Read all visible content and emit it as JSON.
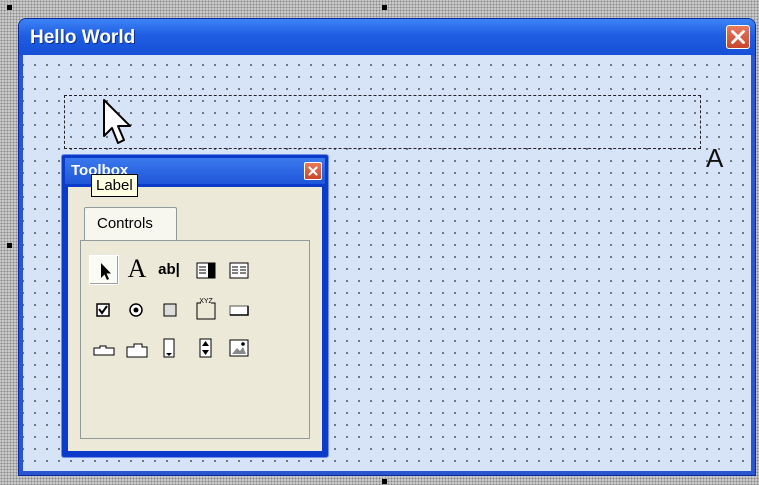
{
  "window": {
    "title": "Hello World"
  },
  "toolbox": {
    "title": "Toolbox",
    "tab_label": "Controls",
    "tooltip": "Label",
    "tools": [
      {
        "name": "select-objects-tool-icon",
        "glyph": "➤"
      },
      {
        "name": "label-tool-icon",
        "glyph": "A"
      },
      {
        "name": "textbox-tool-icon",
        "glyph": "ab|"
      },
      {
        "name": "combobox-tool-icon",
        "glyph": ""
      },
      {
        "name": "listbox-tool-icon",
        "glyph": ""
      },
      {
        "name": "checkbox-tool-icon",
        "glyph": ""
      },
      {
        "name": "optionbutton-tool-icon",
        "glyph": ""
      },
      {
        "name": "togglebutton-tool-icon",
        "glyph": ""
      },
      {
        "name": "frame-tool-icon",
        "glyph": "XYZ"
      },
      {
        "name": "commandbutton-tool-icon",
        "glyph": ""
      },
      {
        "name": "tabstrip-tool-icon",
        "glyph": ""
      },
      {
        "name": "multipage-tool-icon",
        "glyph": ""
      },
      {
        "name": "scrollbar-tool-icon",
        "glyph": ""
      },
      {
        "name": "spinbutton-tool-icon",
        "glyph": ""
      },
      {
        "name": "image-tool-icon",
        "glyph": ""
      }
    ]
  },
  "form": {
    "label_cursor_glyph": "A"
  }
}
